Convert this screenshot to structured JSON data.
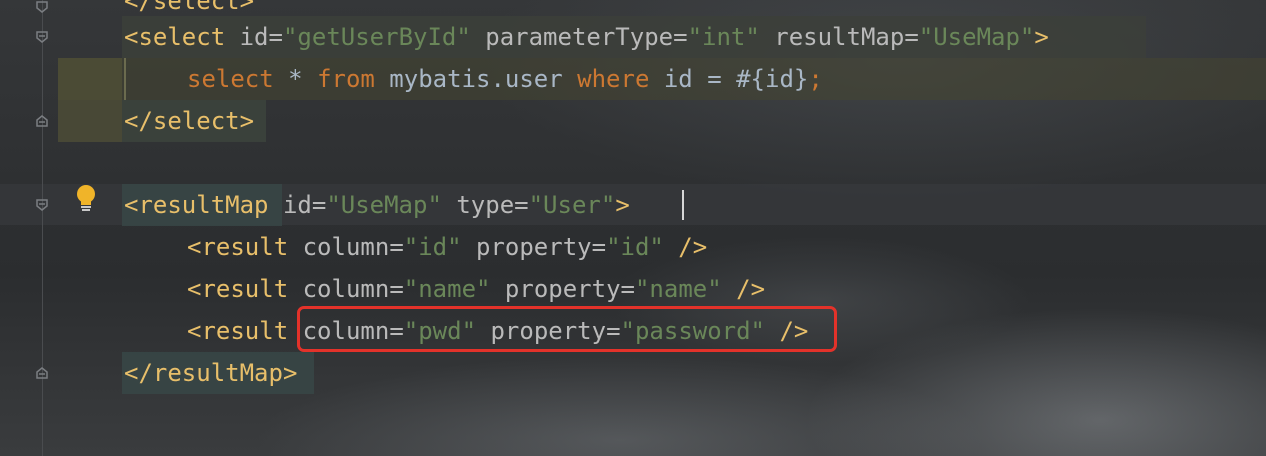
{
  "editor": {
    "lines": [
      {
        "parts": [
          {
            "t": "</select>",
            "c": "tag"
          }
        ]
      },
      {
        "parts": [
          {
            "t": "<select",
            "c": "tag"
          },
          {
            "t": " id",
            "c": "attr"
          },
          {
            "t": "=",
            "c": "eq"
          },
          {
            "t": "\"getUserById\"",
            "c": "val"
          },
          {
            "t": " parameterType",
            "c": "attr"
          },
          {
            "t": "=",
            "c": "eq"
          },
          {
            "t": "\"int\"",
            "c": "val"
          },
          {
            "t": " resultMap",
            "c": "attr"
          },
          {
            "t": "=",
            "c": "eq"
          },
          {
            "t": "\"UseMap\"",
            "c": "val"
          },
          {
            "t": ">",
            "c": "tag"
          }
        ]
      },
      {
        "parts": [
          {
            "t": "select",
            "c": "kw"
          },
          {
            "t": " * ",
            "c": "txt"
          },
          {
            "t": "from",
            "c": "kw"
          },
          {
            "t": " mybatis.user ",
            "c": "txt"
          },
          {
            "t": "where",
            "c": "kw"
          },
          {
            "t": " id = #{id}",
            "c": "txt"
          },
          {
            "t": ";",
            "c": "kw"
          }
        ]
      },
      {
        "parts": [
          {
            "t": "</select>",
            "c": "tag"
          }
        ]
      },
      {
        "parts": []
      },
      {
        "parts": [
          {
            "t": "<resultMap",
            "c": "tag"
          },
          {
            "t": " id",
            "c": "attr"
          },
          {
            "t": "=",
            "c": "eq"
          },
          {
            "t": "\"UseMap\"",
            "c": "val"
          },
          {
            "t": " type",
            "c": "attr"
          },
          {
            "t": "=",
            "c": "eq"
          },
          {
            "t": "\"User\"",
            "c": "val"
          },
          {
            "t": ">",
            "c": "tag"
          }
        ]
      },
      {
        "parts": [
          {
            "t": "<result",
            "c": "tag"
          },
          {
            "t": " column",
            "c": "attr"
          },
          {
            "t": "=",
            "c": "eq"
          },
          {
            "t": "\"id\"",
            "c": "val"
          },
          {
            "t": " property",
            "c": "attr"
          },
          {
            "t": "=",
            "c": "eq"
          },
          {
            "t": "\"id\"",
            "c": "val"
          },
          {
            "t": " />",
            "c": "tag"
          }
        ]
      },
      {
        "parts": [
          {
            "t": "<result",
            "c": "tag"
          },
          {
            "t": " column",
            "c": "attr"
          },
          {
            "t": "=",
            "c": "eq"
          },
          {
            "t": "\"name\"",
            "c": "val"
          },
          {
            "t": " property",
            "c": "attr"
          },
          {
            "t": "=",
            "c": "eq"
          },
          {
            "t": "\"name\"",
            "c": "val"
          },
          {
            "t": " />",
            "c": "tag"
          }
        ]
      },
      {
        "parts": [
          {
            "t": "<result",
            "c": "tag"
          },
          {
            "t": " column",
            "c": "attr"
          },
          {
            "t": "=",
            "c": "eq"
          },
          {
            "t": "\"pwd\"",
            "c": "val"
          },
          {
            "t": " property",
            "c": "attr"
          },
          {
            "t": "=",
            "c": "eq"
          },
          {
            "t": "\"password\"",
            "c": "val"
          },
          {
            "t": " />",
            "c": "tag"
          }
        ]
      },
      {
        "parts": [
          {
            "t": "</resultMap>",
            "c": "tag"
          }
        ]
      }
    ]
  },
  "gutter": {
    "bulb_icon": "lightbulb-icon",
    "fold_icon": "fold-marker-icon"
  },
  "colors": {
    "tag": "#e8bf6a",
    "attribute": "#bababa",
    "string": "#6a8759",
    "keyword": "#cc7832",
    "highlight_box": "#e3322a"
  }
}
